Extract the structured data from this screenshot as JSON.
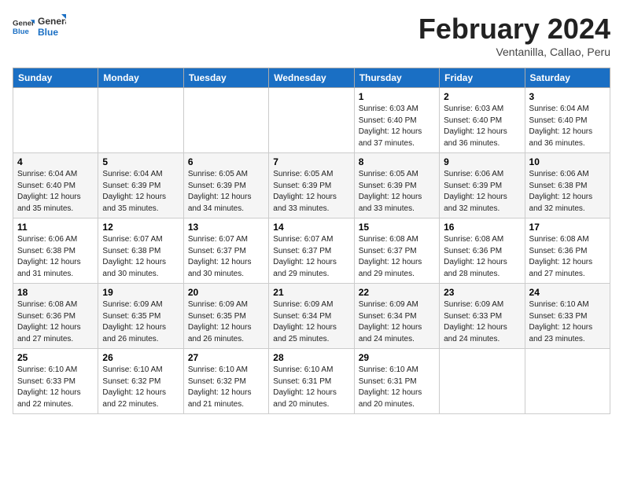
{
  "header": {
    "logo_general": "General",
    "logo_blue": "Blue",
    "month_title": "February 2024",
    "subtitle": "Ventanilla, Callao, Peru"
  },
  "weekdays": [
    "Sunday",
    "Monday",
    "Tuesday",
    "Wednesday",
    "Thursday",
    "Friday",
    "Saturday"
  ],
  "weeks": [
    [
      {
        "day": "",
        "info": ""
      },
      {
        "day": "",
        "info": ""
      },
      {
        "day": "",
        "info": ""
      },
      {
        "day": "",
        "info": ""
      },
      {
        "day": "1",
        "info": "Sunrise: 6:03 AM\nSunset: 6:40 PM\nDaylight: 12 hours\nand 37 minutes."
      },
      {
        "day": "2",
        "info": "Sunrise: 6:03 AM\nSunset: 6:40 PM\nDaylight: 12 hours\nand 36 minutes."
      },
      {
        "day": "3",
        "info": "Sunrise: 6:04 AM\nSunset: 6:40 PM\nDaylight: 12 hours\nand 36 minutes."
      }
    ],
    [
      {
        "day": "4",
        "info": "Sunrise: 6:04 AM\nSunset: 6:40 PM\nDaylight: 12 hours\nand 35 minutes."
      },
      {
        "day": "5",
        "info": "Sunrise: 6:04 AM\nSunset: 6:39 PM\nDaylight: 12 hours\nand 35 minutes."
      },
      {
        "day": "6",
        "info": "Sunrise: 6:05 AM\nSunset: 6:39 PM\nDaylight: 12 hours\nand 34 minutes."
      },
      {
        "day": "7",
        "info": "Sunrise: 6:05 AM\nSunset: 6:39 PM\nDaylight: 12 hours\nand 33 minutes."
      },
      {
        "day": "8",
        "info": "Sunrise: 6:05 AM\nSunset: 6:39 PM\nDaylight: 12 hours\nand 33 minutes."
      },
      {
        "day": "9",
        "info": "Sunrise: 6:06 AM\nSunset: 6:39 PM\nDaylight: 12 hours\nand 32 minutes."
      },
      {
        "day": "10",
        "info": "Sunrise: 6:06 AM\nSunset: 6:38 PM\nDaylight: 12 hours\nand 32 minutes."
      }
    ],
    [
      {
        "day": "11",
        "info": "Sunrise: 6:06 AM\nSunset: 6:38 PM\nDaylight: 12 hours\nand 31 minutes."
      },
      {
        "day": "12",
        "info": "Sunrise: 6:07 AM\nSunset: 6:38 PM\nDaylight: 12 hours\nand 30 minutes."
      },
      {
        "day": "13",
        "info": "Sunrise: 6:07 AM\nSunset: 6:37 PM\nDaylight: 12 hours\nand 30 minutes."
      },
      {
        "day": "14",
        "info": "Sunrise: 6:07 AM\nSunset: 6:37 PM\nDaylight: 12 hours\nand 29 minutes."
      },
      {
        "day": "15",
        "info": "Sunrise: 6:08 AM\nSunset: 6:37 PM\nDaylight: 12 hours\nand 29 minutes."
      },
      {
        "day": "16",
        "info": "Sunrise: 6:08 AM\nSunset: 6:36 PM\nDaylight: 12 hours\nand 28 minutes."
      },
      {
        "day": "17",
        "info": "Sunrise: 6:08 AM\nSunset: 6:36 PM\nDaylight: 12 hours\nand 27 minutes."
      }
    ],
    [
      {
        "day": "18",
        "info": "Sunrise: 6:08 AM\nSunset: 6:36 PM\nDaylight: 12 hours\nand 27 minutes."
      },
      {
        "day": "19",
        "info": "Sunrise: 6:09 AM\nSunset: 6:35 PM\nDaylight: 12 hours\nand 26 minutes."
      },
      {
        "day": "20",
        "info": "Sunrise: 6:09 AM\nSunset: 6:35 PM\nDaylight: 12 hours\nand 26 minutes."
      },
      {
        "day": "21",
        "info": "Sunrise: 6:09 AM\nSunset: 6:34 PM\nDaylight: 12 hours\nand 25 minutes."
      },
      {
        "day": "22",
        "info": "Sunrise: 6:09 AM\nSunset: 6:34 PM\nDaylight: 12 hours\nand 24 minutes."
      },
      {
        "day": "23",
        "info": "Sunrise: 6:09 AM\nSunset: 6:33 PM\nDaylight: 12 hours\nand 24 minutes."
      },
      {
        "day": "24",
        "info": "Sunrise: 6:10 AM\nSunset: 6:33 PM\nDaylight: 12 hours\nand 23 minutes."
      }
    ],
    [
      {
        "day": "25",
        "info": "Sunrise: 6:10 AM\nSunset: 6:33 PM\nDaylight: 12 hours\nand 22 minutes."
      },
      {
        "day": "26",
        "info": "Sunrise: 6:10 AM\nSunset: 6:32 PM\nDaylight: 12 hours\nand 22 minutes."
      },
      {
        "day": "27",
        "info": "Sunrise: 6:10 AM\nSunset: 6:32 PM\nDaylight: 12 hours\nand 21 minutes."
      },
      {
        "day": "28",
        "info": "Sunrise: 6:10 AM\nSunset: 6:31 PM\nDaylight: 12 hours\nand 20 minutes."
      },
      {
        "day": "29",
        "info": "Sunrise: 6:10 AM\nSunset: 6:31 PM\nDaylight: 12 hours\nand 20 minutes."
      },
      {
        "day": "",
        "info": ""
      },
      {
        "day": "",
        "info": ""
      }
    ]
  ]
}
